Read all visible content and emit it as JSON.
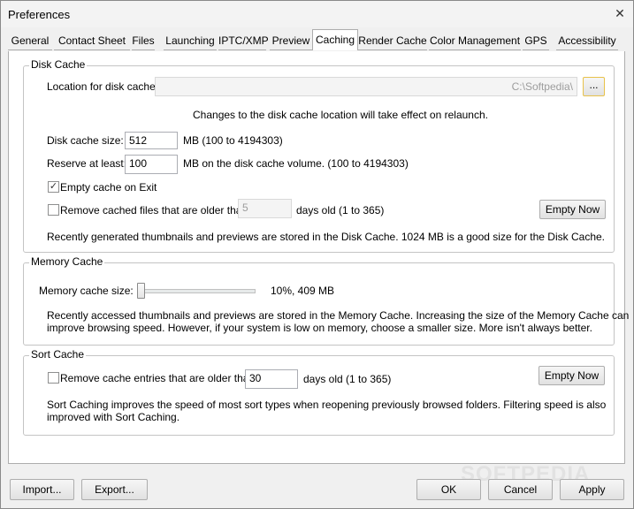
{
  "window": {
    "title": "Preferences"
  },
  "tabs": [
    {
      "label": "General"
    },
    {
      "label": "Contact Sheet"
    },
    {
      "label": "Files"
    },
    {
      "label": "Launching"
    },
    {
      "label": "IPTC/XMP"
    },
    {
      "label": "Preview"
    },
    {
      "label": "Caching"
    },
    {
      "label": "Render Cache"
    },
    {
      "label": "Color Management"
    },
    {
      "label": "GPS"
    },
    {
      "label": "Accessibility"
    }
  ],
  "disk_cache": {
    "title": "Disk Cache",
    "location_label": "Location for disk cache:",
    "location_value": "C:\\Softpedia\\",
    "browse_label": "...",
    "relaunch_note": "Changes to the disk cache location will take effect on relaunch.",
    "size_label": "Disk cache size:",
    "size_value": "512",
    "size_unit": "MB (100 to 4194303)",
    "reserve_label": "Reserve at least:",
    "reserve_value": "100",
    "reserve_unit": "MB on the disk cache volume. (100 to 4194303)",
    "empty_on_exit_label": "Empty cache on Exit",
    "empty_on_exit_checked": true,
    "remove_older_label": "Remove cached files that are older than",
    "remove_older_checked": false,
    "remove_older_value": "5",
    "remove_older_unit": "days old (1 to 365)",
    "empty_now_label": "Empty Now",
    "info": "Recently generated thumbnails and previews are stored in the Disk Cache.  1024 MB is a good size for the Disk Cache."
  },
  "memory_cache": {
    "title": "Memory Cache",
    "size_label": "Memory cache size:",
    "slider_fraction": 0.1,
    "size_readout": "10%, 409 MB",
    "info_line1": "Recently accessed thumbnails and previews are stored in the Memory Cache.  Increasing the size of the Memory Cache can",
    "info_line2": "improve browsing speed.  However, if your system is low on memory, choose a smaller size.  More isn't always better."
  },
  "sort_cache": {
    "title": "Sort Cache",
    "remove_older_label": "Remove cache entries that are older than",
    "remove_older_checked": false,
    "remove_older_value": "30",
    "remove_older_unit": "days old (1 to 365)",
    "empty_now_label": "Empty Now",
    "info_line1": "Sort Caching improves the speed of most sort types when reopening previously browsed folders.  Filtering speed is also",
    "info_line2": "improved with Sort Caching."
  },
  "footer": {
    "import_label": "Import...",
    "export_label": "Export...",
    "ok_label": "OK",
    "cancel_label": "Cancel",
    "apply_label": "Apply"
  },
  "watermark": "SOFTPEDIA"
}
